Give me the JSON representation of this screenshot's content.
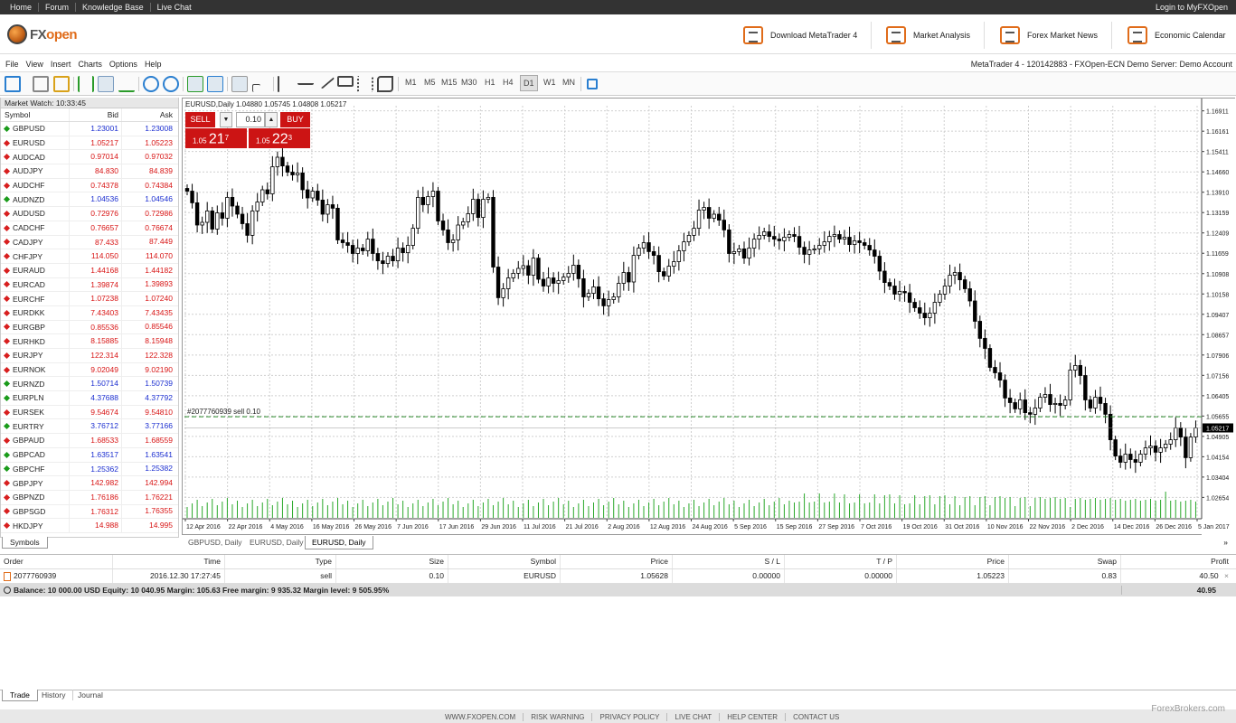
{
  "topbar": {
    "links": [
      "Home",
      "Forum",
      "Knowledge Base",
      "Live Chat"
    ],
    "login": "Login to MyFXOpen"
  },
  "brand": {
    "logo_a": "FX",
    "logo_b": "open",
    "nav": [
      "Download MetaTrader 4",
      "Market Analysis",
      "Forex Market News",
      "Economic Calendar"
    ]
  },
  "menu": {
    "items": [
      "File",
      "View",
      "Insert",
      "Charts",
      "Options",
      "Help"
    ],
    "account": "MetaTrader 4 - 120142883 - FXOpen-ECN Demo Server: Demo Account"
  },
  "toolbar": {
    "timeframes": [
      "M1",
      "M5",
      "M15",
      "M30",
      "H1",
      "H4",
      "D1",
      "W1",
      "MN"
    ],
    "active_timeframe": "D1"
  },
  "market_watch": {
    "title": "Market Watch: 10:33:45",
    "headers": {
      "symbol": "Symbol",
      "bid": "Bid",
      "ask": "Ask"
    },
    "rows": [
      {
        "s": "GBPUSD",
        "b": "1.23001",
        "a": "1.23008",
        "d": "up"
      },
      {
        "s": "EURUSD",
        "b": "1.05217",
        "a": "1.05223",
        "d": "dn"
      },
      {
        "s": "AUDCAD",
        "b": "0.97014",
        "a": "0.97032",
        "d": "dn"
      },
      {
        "s": "AUDJPY",
        "b": "84.830",
        "a": "84.839",
        "d": "dn"
      },
      {
        "s": "AUDCHF",
        "b": "0.74378",
        "a": "0.74384",
        "d": "dn"
      },
      {
        "s": "AUDNZD",
        "b": "1.04536",
        "a": "1.04546",
        "d": "up"
      },
      {
        "s": "AUDUSD",
        "b": "0.72976",
        "a": "0.72986",
        "d": "dn"
      },
      {
        "s": "CADCHF",
        "b": "0.76657",
        "a": "0.76674",
        "d": "dn"
      },
      {
        "s": "CADJPY",
        "b": "87.433",
        "a": "87.449",
        "d": "dn"
      },
      {
        "s": "CHFJPY",
        "b": "114.050",
        "a": "114.070",
        "d": "dn"
      },
      {
        "s": "EURAUD",
        "b": "1.44168",
        "a": "1.44182",
        "d": "dn"
      },
      {
        "s": "EURCAD",
        "b": "1.39874",
        "a": "1.39893",
        "d": "dn"
      },
      {
        "s": "EURCHF",
        "b": "1.07238",
        "a": "1.07240",
        "d": "dn"
      },
      {
        "s": "EURDKK",
        "b": "7.43403",
        "a": "7.43435",
        "d": "dn"
      },
      {
        "s": "EURGBP",
        "b": "0.85536",
        "a": "0.85546",
        "d": "dn"
      },
      {
        "s": "EURHKD",
        "b": "8.15885",
        "a": "8.15948",
        "d": "dn"
      },
      {
        "s": "EURJPY",
        "b": "122.314",
        "a": "122.328",
        "d": "dn"
      },
      {
        "s": "EURNOK",
        "b": "9.02049",
        "a": "9.02190",
        "d": "dn"
      },
      {
        "s": "EURNZD",
        "b": "1.50714",
        "a": "1.50739",
        "d": "up"
      },
      {
        "s": "EURPLN",
        "b": "4.37688",
        "a": "4.37792",
        "d": "up"
      },
      {
        "s": "EURSEK",
        "b": "9.54674",
        "a": "9.54810",
        "d": "dn"
      },
      {
        "s": "EURTRY",
        "b": "3.76712",
        "a": "3.77166",
        "d": "up"
      },
      {
        "s": "GBPAUD",
        "b": "1.68533",
        "a": "1.68559",
        "d": "dn"
      },
      {
        "s": "GBPCAD",
        "b": "1.63517",
        "a": "1.63541",
        "d": "up"
      },
      {
        "s": "GBPCHF",
        "b": "1.25362",
        "a": "1.25382",
        "d": "up"
      },
      {
        "s": "GBPJPY",
        "b": "142.982",
        "a": "142.994",
        "d": "dn"
      },
      {
        "s": "GBPNZD",
        "b": "1.76186",
        "a": "1.76221",
        "d": "dn"
      },
      {
        "s": "GBPSGD",
        "b": "1.76312",
        "a": "1.76355",
        "d": "dn"
      },
      {
        "s": "HKDJPY",
        "b": "14.988",
        "a": "14.995",
        "d": "dn"
      }
    ],
    "tab": "Symbols"
  },
  "chart": {
    "title": "EURUSD,Daily  1.04880 1.05745 1.04808 1.05217",
    "sell_label": "SELL",
    "buy_label": "BUY",
    "lot": "0.10",
    "sell_price": {
      "pre": "1.05",
      "big": "21",
      "sup": "7"
    },
    "buy_price": {
      "pre": "1.05",
      "big": "22",
      "sup": "3"
    },
    "order_label": "#2077760939 sell 0.10",
    "order_level": 1.05628,
    "current_price": "1.05217",
    "y_ticks": [
      "1.16911",
      "1.16161",
      "1.15411",
      "1.14660",
      "1.13910",
      "1.13159",
      "1.12409",
      "1.11659",
      "1.10908",
      "1.10158",
      "1.09407",
      "1.08657",
      "1.07906",
      "1.07156",
      "1.06405",
      "1.05655",
      "1.04905",
      "1.04154",
      "1.03404",
      "1.02654"
    ],
    "x_ticks": [
      "12 Apr 2016",
      "22 Apr 2016",
      "4 May 2016",
      "16 May 2016",
      "26 May 2016",
      "7 Jun 2016",
      "17 Jun 2016",
      "29 Jun 2016",
      "11 Jul 2016",
      "21 Jul 2016",
      "2 Aug 2016",
      "12 Aug 2016",
      "24 Aug 2016",
      "5 Sep 2016",
      "15 Sep 2016",
      "27 Sep 2016",
      "7 Oct 2016",
      "19 Oct 2016",
      "31 Oct 2016",
      "10 Nov 2016",
      "22 Nov 2016",
      "2 Dec 2016",
      "14 Dec 2016",
      "26 Dec 2016",
      "5 Jan 2017"
    ],
    "tabs": [
      "GBPUSD, Daily",
      "EURUSD, Daily",
      "EURUSD, Daily"
    ],
    "active_tab": 2
  },
  "chart_data": {
    "type": "candlestick",
    "ylim": [
      1.022,
      1.171
    ],
    "closes": [
      1.1395,
      1.1352,
      1.127,
      1.128,
      1.1322,
      1.1255,
      1.1315,
      1.1295,
      1.1372,
      1.134,
      1.131,
      1.1275,
      1.1232,
      1.1322,
      1.1355,
      1.14,
      1.1385,
      1.1485,
      1.152,
      1.1488,
      1.1465,
      1.1455,
      1.1462,
      1.14,
      1.137,
      1.1395,
      1.1362,
      1.131,
      1.1345,
      1.1332,
      1.1215,
      1.1205,
      1.1195,
      1.1165,
      1.1185,
      1.1175,
      1.1218,
      1.1165,
      1.1138,
      1.1128,
      1.1155,
      1.1138,
      1.1185,
      1.1168,
      1.1195,
      1.1258,
      1.1372,
      1.1345,
      1.1375,
      1.1395,
      1.1285,
      1.1252,
      1.1205,
      1.1215,
      1.127,
      1.1282,
      1.1312,
      1.1365,
      1.1298,
      1.1365,
      1.1372,
      1.1115,
      1.1002,
      1.1035,
      1.1075,
      1.1092,
      1.111,
      1.112,
      1.1085,
      1.1148,
      1.107,
      1.1045,
      1.1075,
      1.1055,
      1.1065,
      1.1078,
      1.1092,
      1.1122,
      1.1072,
      1.1005,
      1.1018,
      1.1042,
      1.0998,
      1.0972,
      1.0995,
      1.1005,
      1.1055,
      1.1095,
      1.106,
      1.1158,
      1.1185,
      1.1205,
      1.1172,
      1.1158,
      1.1098,
      1.1082,
      1.1118,
      1.1135,
      1.1175,
      1.1208,
      1.1232,
      1.1258,
      1.1325,
      1.1335,
      1.1295,
      1.131,
      1.1288,
      1.1252,
      1.1165,
      1.1172,
      1.1182,
      1.1148,
      1.1185,
      1.1218,
      1.1232,
      1.1245,
      1.1228,
      1.1218,
      1.1212,
      1.1225,
      1.1235,
      1.1228,
      1.1188,
      1.1162,
      1.1178,
      1.1182,
      1.1195,
      1.1208,
      1.1228,
      1.1235,
      1.1218,
      1.1225,
      1.1198,
      1.1212,
      1.1205,
      1.1195,
      1.1178,
      1.1155,
      1.11,
      1.1058,
      1.1045,
      1.1015,
      1.1025,
      1.102,
      1.0985,
      1.0965,
      1.0945,
      1.0928,
      1.0945,
      1.0985,
      1.1015,
      1.1045,
      1.1085,
      1.1095,
      1.1068,
      1.1035,
      1.099,
      1.0915,
      1.0852,
      1.0815,
      1.0745,
      1.0725,
      1.0698,
      1.0632,
      1.0615,
      1.0592,
      1.0625,
      1.0578,
      1.0572,
      1.0595,
      1.0635,
      1.0645,
      1.0608,
      1.0612,
      1.0605,
      1.0625,
      1.0735,
      1.0752,
      1.0715,
      1.0625,
      1.0595,
      1.0635,
      1.0612,
      1.0572,
      1.0478,
      1.0418,
      1.0395,
      1.0425,
      1.0405,
      1.0395,
      1.0425,
      1.0448,
      1.0455,
      1.0432,
      1.0448,
      1.0462,
      1.0478,
      1.0522,
      1.0488,
      1.0412,
      1.0488,
      1.0522
    ]
  },
  "terminal": {
    "headers": [
      "Order",
      "Time",
      "Type",
      "Size",
      "Symbol",
      "Price",
      "S / L",
      "T / P",
      "Price",
      "Swap",
      "Profit"
    ],
    "row": [
      "2077760939",
      "2016.12.30 17:27:45",
      "sell",
      "0.10",
      "EURUSD",
      "1.05628",
      "0.00000",
      "0.00000",
      "1.05223",
      "0.83",
      "40.50"
    ],
    "close_glyph": "×",
    "balance": "Balance: 10 000.00 USD  Equity: 10 040.95  Margin: 105.63  Free margin: 9 935.32  Margin level: 9 505.95%",
    "total": "40.95",
    "tabs": [
      "Trade",
      "History",
      "Journal"
    ]
  },
  "footer": {
    "links": [
      "WWW.FXOPEN.COM",
      "RISK WARNING",
      "PRIVACY POLICY",
      "LIVE CHAT",
      "HELP CENTER",
      "CONTACT US"
    ],
    "watermark": "ForexBrokers.com"
  },
  "colors": {
    "sell": "#cc1414",
    "accent": "#e06c1a",
    "grid": "#c8c8c8",
    "volume": "#2aa82a",
    "order_line": "#2a8a2a"
  }
}
